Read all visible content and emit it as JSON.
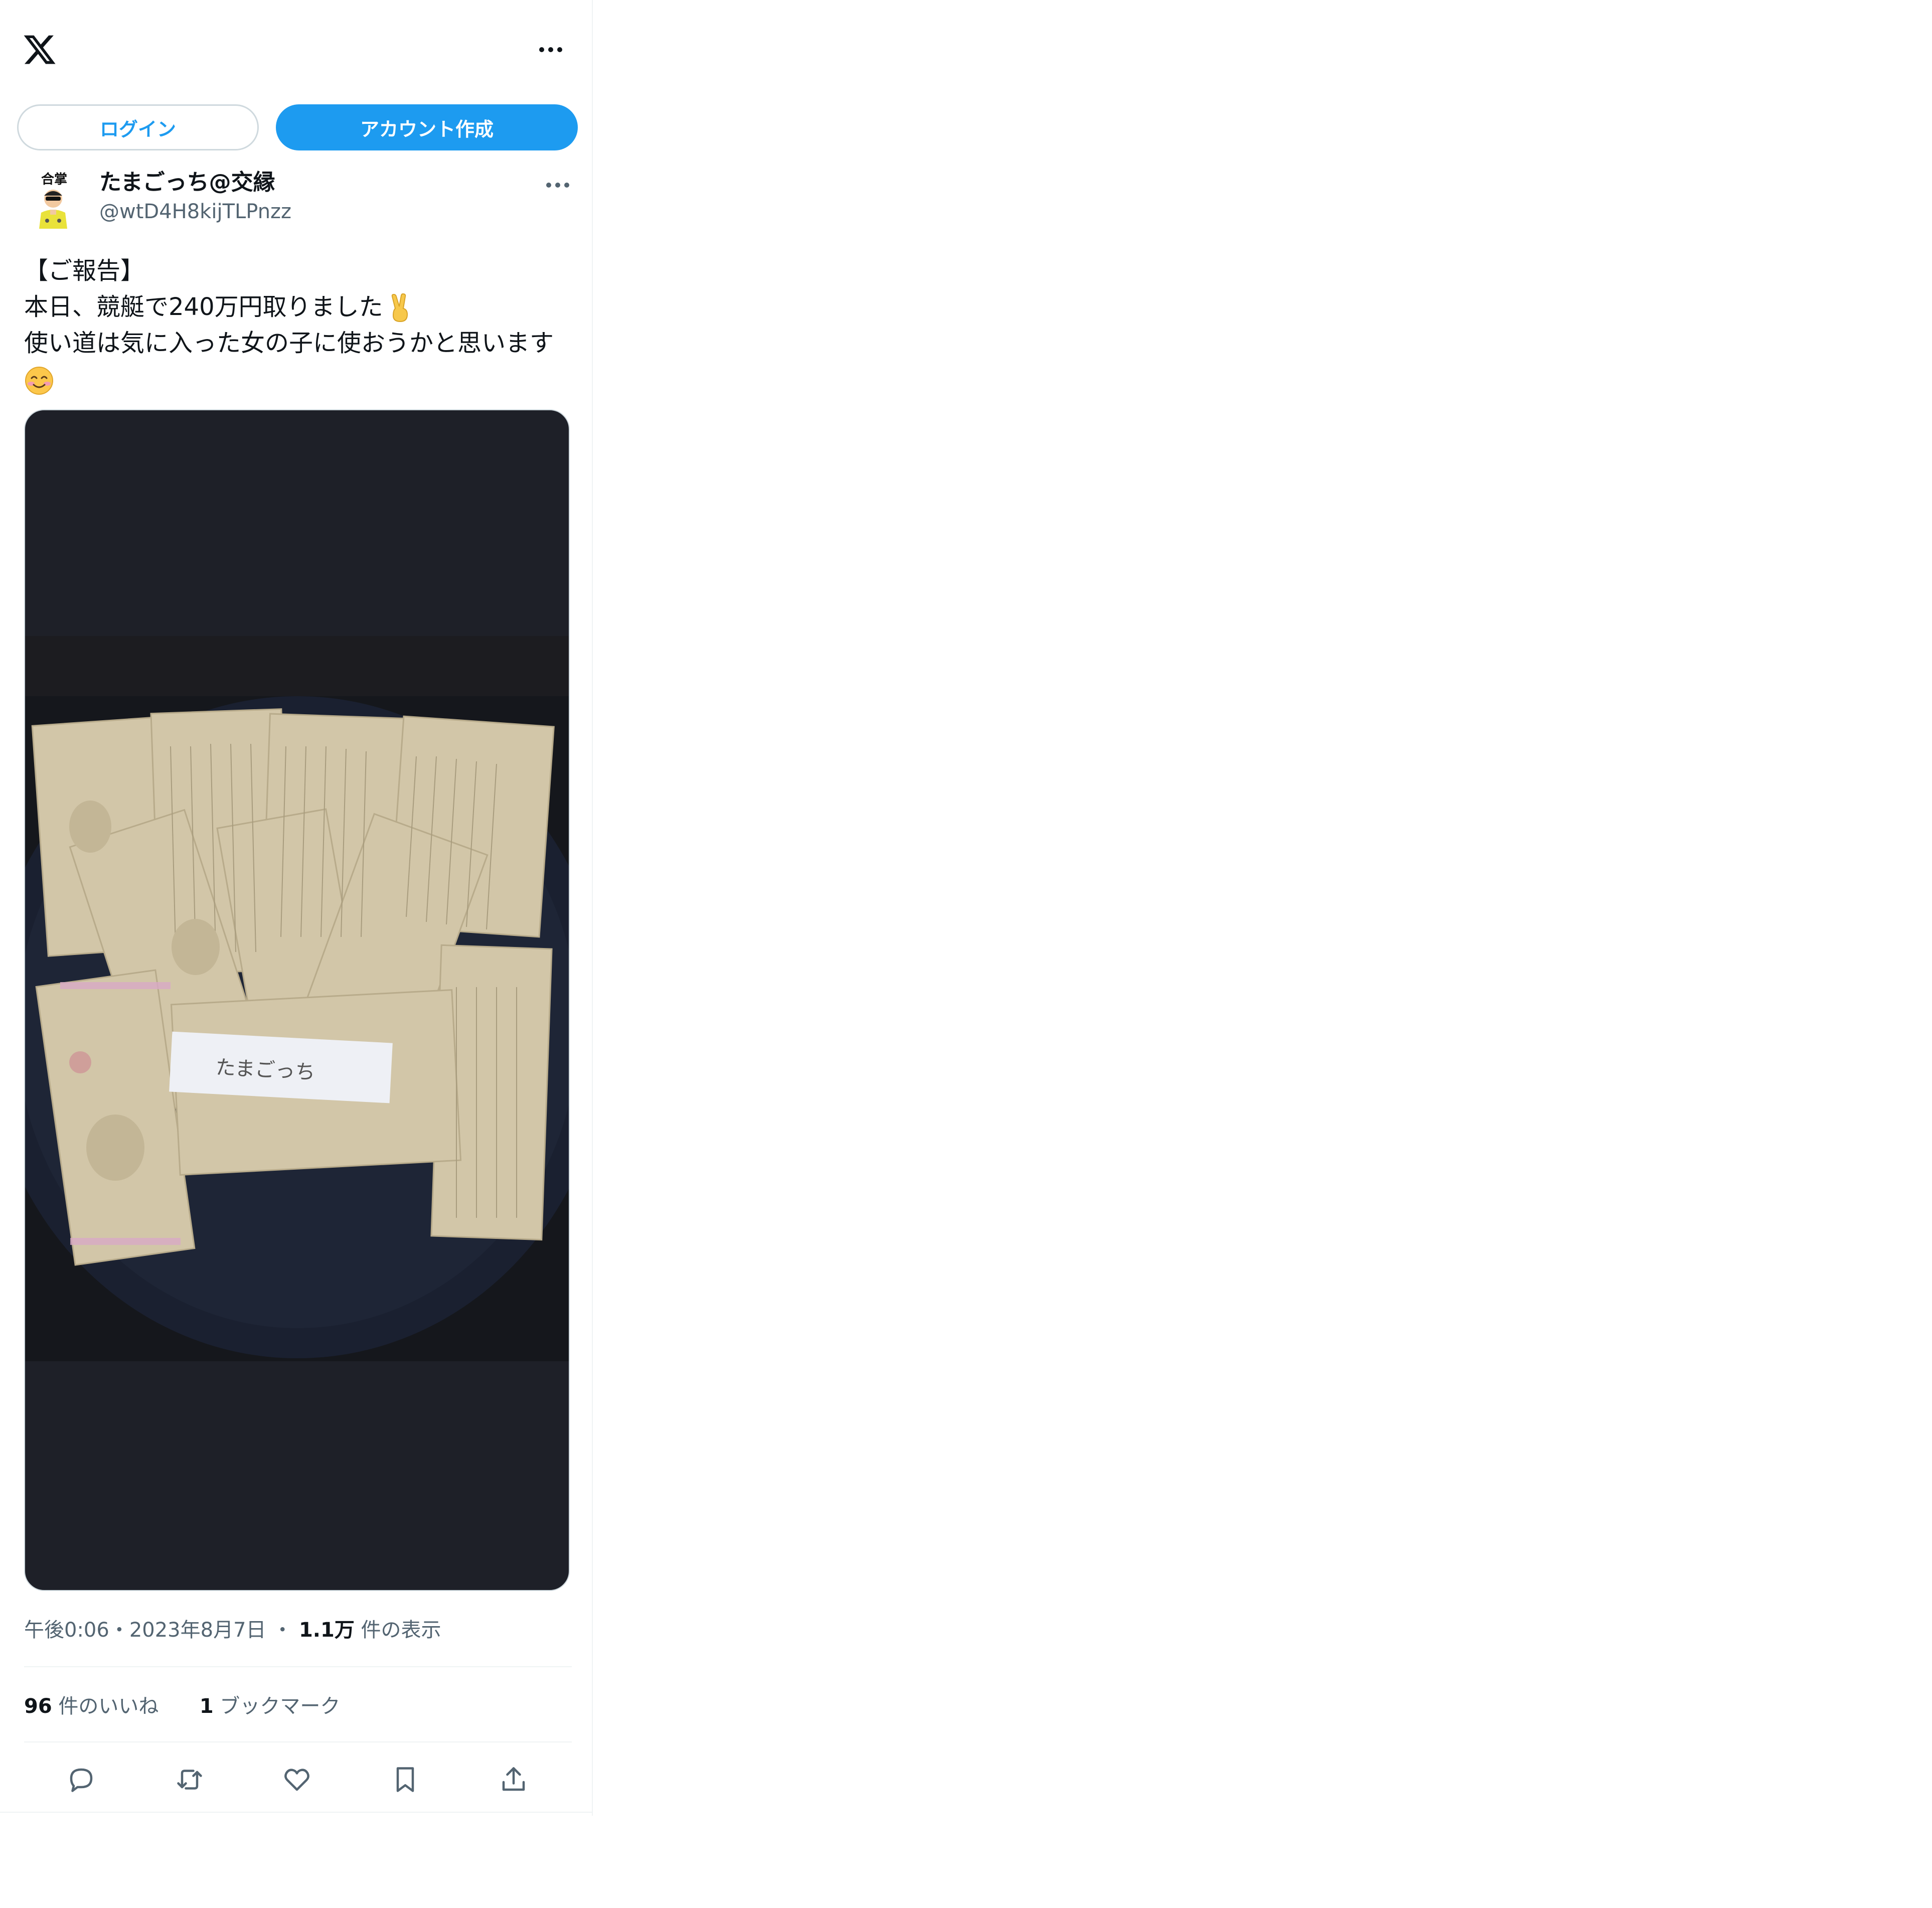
{
  "header": {
    "logo_icon": "x-logo-icon",
    "more_icon": "more-horizontal-icon"
  },
  "auth": {
    "login_label": "ログイン",
    "signup_label": "アカウント作成",
    "accent_color": "#1d9bf0"
  },
  "tweet": {
    "author": {
      "display_name": "たまごっち@交縁",
      "handle": "@wtD4H8kijTLPnzz",
      "avatar_text": "合掌"
    },
    "text_lines": [
      "【ご報告】",
      "本日、競艇で240万円取りました",
      "使い道は気に入った女の子に使おうかと思います"
    ],
    "emojis": [
      "victory-hand-emoji",
      "smiling-face-emoji"
    ],
    "media": {
      "photo_label": "たまごっち"
    },
    "meta": {
      "time": "午後0:06",
      "sep1": "・",
      "date": "2023年8月7日",
      "sep2": "・",
      "views_count": "1.1万",
      "views_label": "件の表示"
    },
    "stats": {
      "likes_count": "96",
      "likes_label": "件のいいね",
      "bookmarks_count": "1",
      "bookmarks_label": "ブックマーク"
    },
    "actions": [
      {
        "icon": "reply-icon"
      },
      {
        "icon": "retweet-icon"
      },
      {
        "icon": "like-icon"
      },
      {
        "icon": "bookmark-icon"
      },
      {
        "icon": "share-icon"
      }
    ]
  }
}
